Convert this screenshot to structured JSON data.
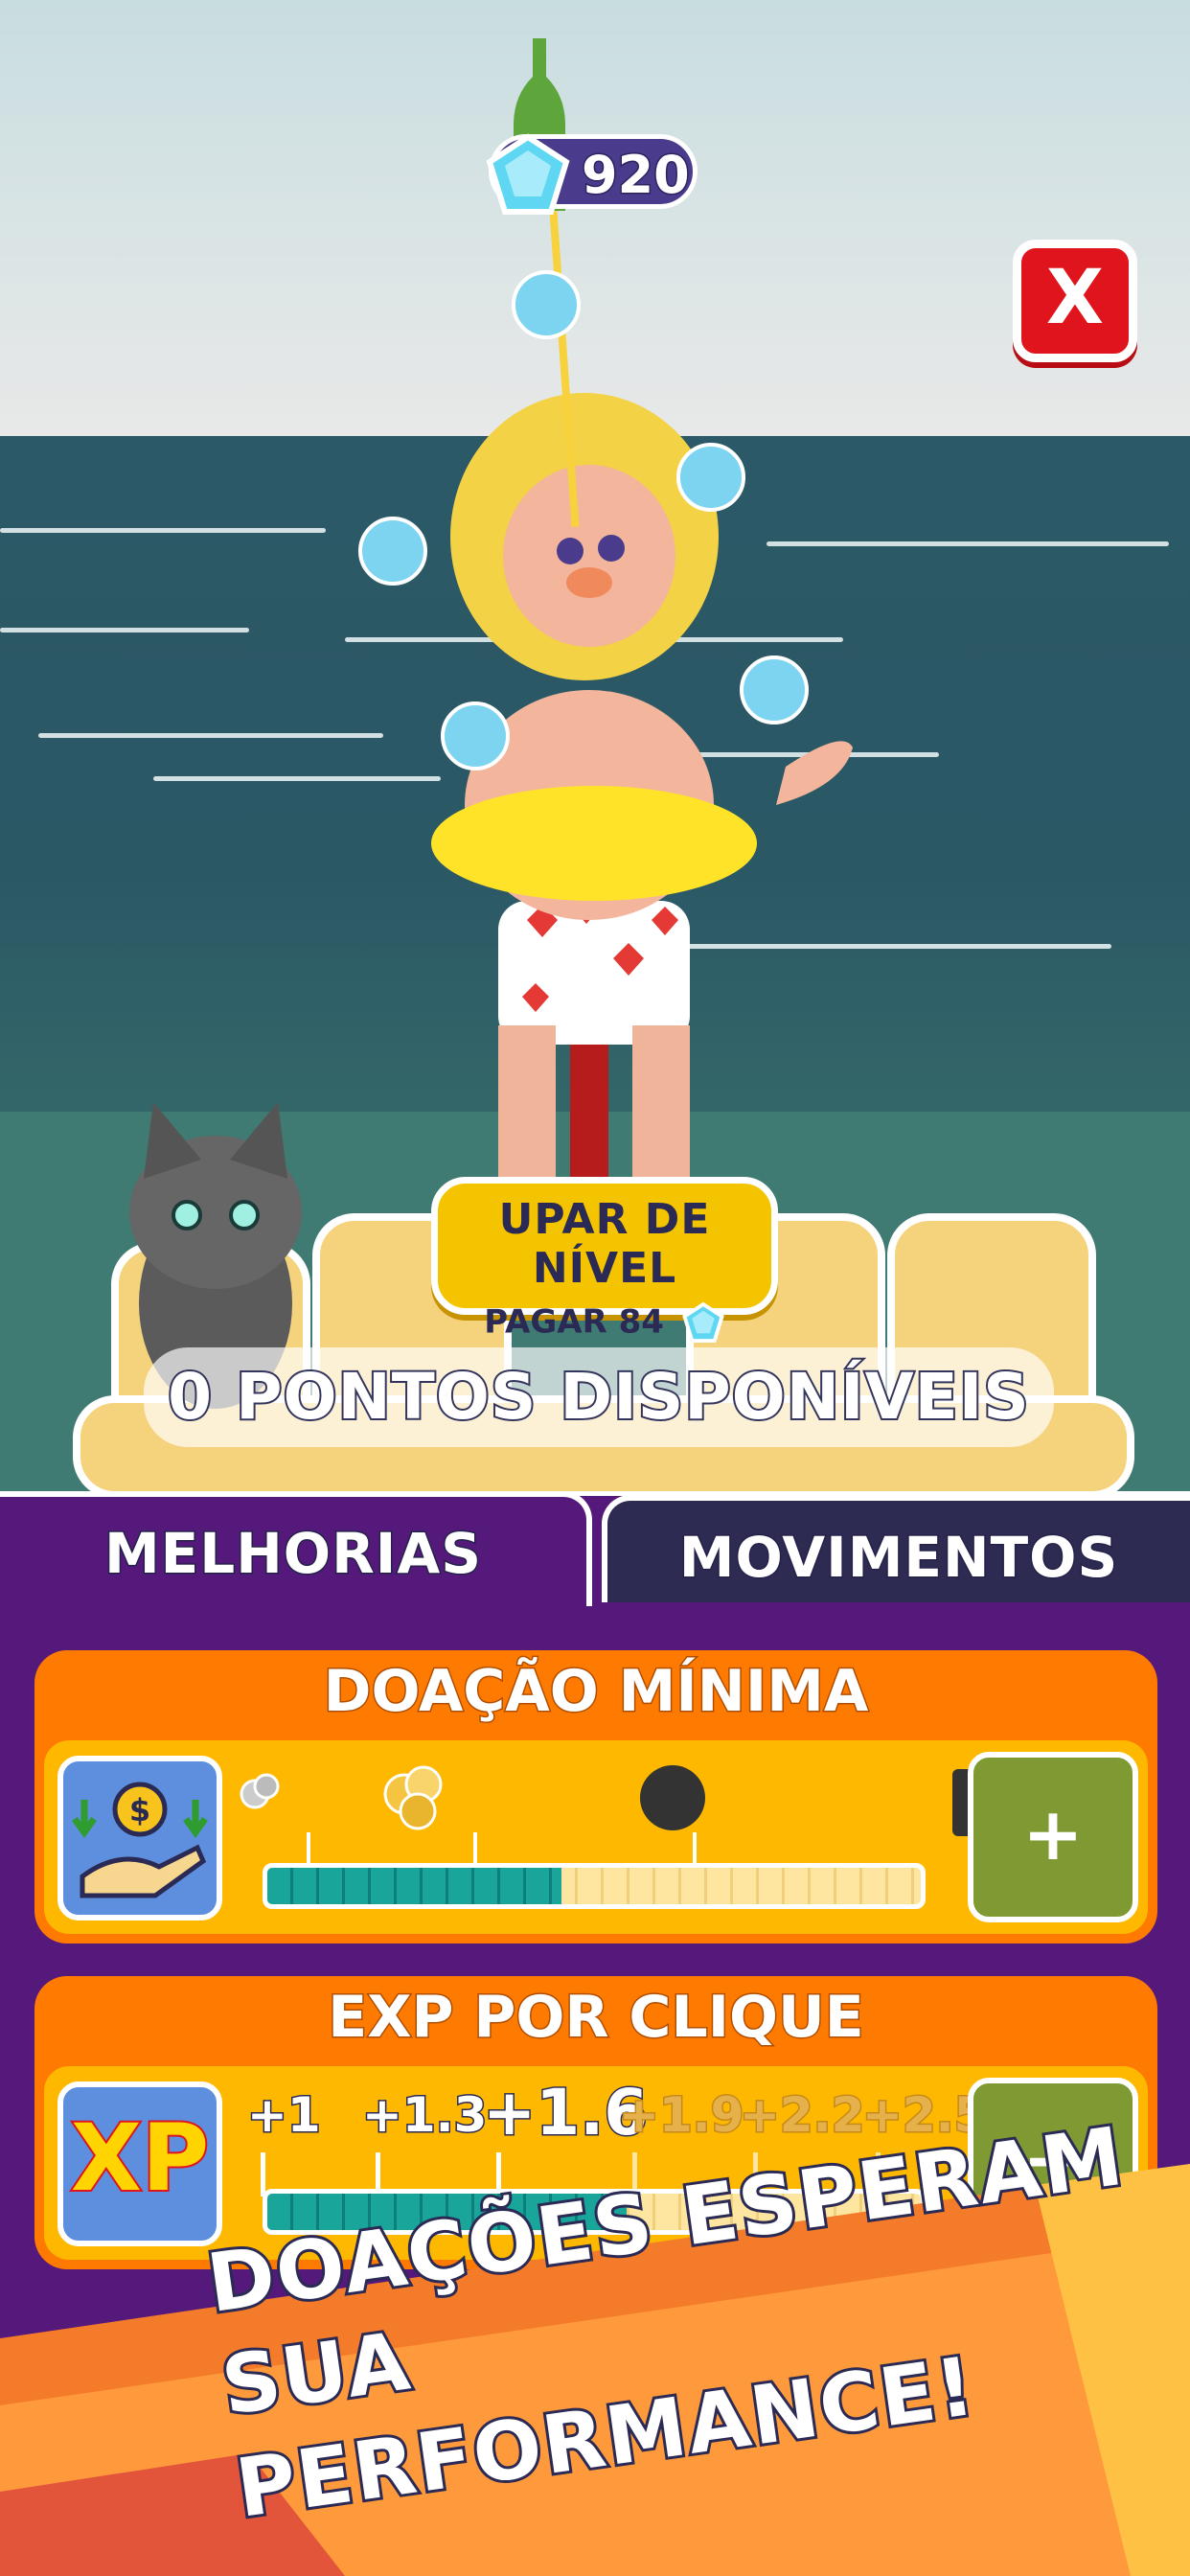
{
  "hud": {
    "gems": "920",
    "close_label": "X"
  },
  "level_up": {
    "title": "UPAR DE NÍVEL",
    "cost": "PAGAR 84"
  },
  "points_banner": "0 PONTOS DISPONÍVEIS",
  "tabs": [
    {
      "label": "MELHORIAS",
      "active": true
    },
    {
      "label": "MOVIMENTOS",
      "active": false
    }
  ],
  "upgrades": [
    {
      "title": "DOAÇÃO MÍNIMA",
      "icon": "coin-donation-icon",
      "progress": 0.45,
      "plus_label": "+"
    },
    {
      "title": "EXP POR CLIQUE",
      "icon": "xp-icon",
      "icon_text": "XP",
      "steps": [
        "+1",
        "+1.3",
        "+1.6",
        "+1.9",
        "+2.2",
        "+2.5"
      ],
      "current_step": 2,
      "progress": 0.55,
      "plus_label": "+"
    }
  ],
  "promo": {
    "line1": "DOAÇÕES ESPERAM",
    "line2": "SUA PERFORMANCE!"
  },
  "colors": {
    "panel": "#55197c",
    "card": "#ff7a00",
    "card_inner": "#ffb800",
    "progress": "#1aa59a",
    "plus_button": "#7f9a32",
    "close_button": "#e0141c"
  }
}
